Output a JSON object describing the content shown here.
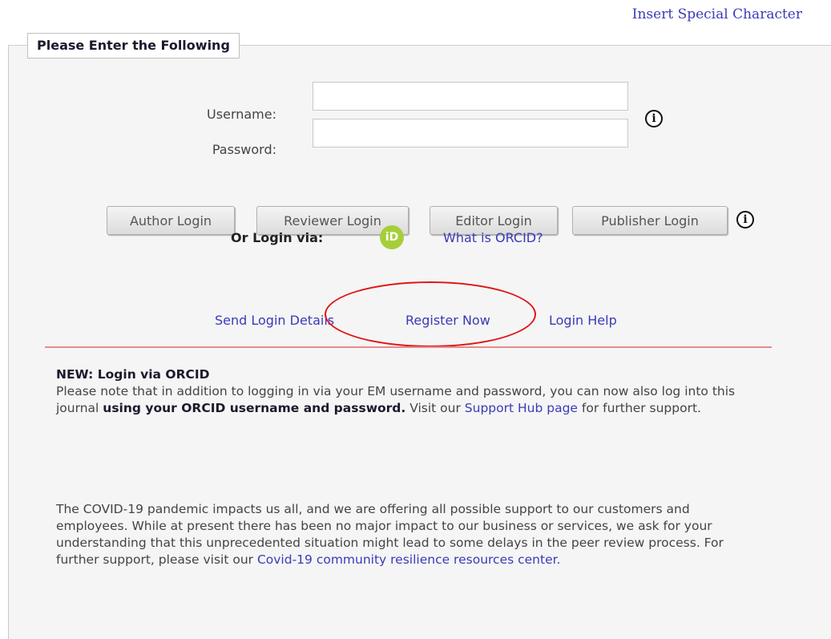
{
  "header": {
    "special_char_link": "Insert Special Character"
  },
  "login_form": {
    "legend": "Please Enter the Following",
    "username_label": "Username:",
    "username_value": "",
    "password_label": "Password:",
    "password_value": "",
    "info_icon_glyph": "i"
  },
  "login_buttons": {
    "author": "Author Login",
    "reviewer": "Reviewer Login",
    "editor": "Editor Login",
    "publisher": "Publisher Login"
  },
  "orcid": {
    "or_login_via": "Or Login via:",
    "badge_text": "iD",
    "badge_color": "#a6ce39",
    "what_is": "What is ORCID?"
  },
  "links": {
    "send_login_details": "Send Login Details",
    "register_now": "Register Now",
    "login_help": "Login Help"
  },
  "notice_orcid": {
    "heading": "NEW: Login via ORCID",
    "text_1": "Please note that in addition to logging in via your EM username and password, you can now also log into this journal ",
    "bold": "using your ORCID username and password.",
    "text_2": " Visit our ",
    "link": "Support Hub page",
    "text_3": " for further support."
  },
  "notice_covid": {
    "text_1": "The COVID-19 pandemic impacts us all, and we are offering all possible support to our customers and employees. While at present there has been no major impact to our business or services, we ask for your understanding that this unprecedented situation might lead to some delays in the peer review process. For further support, please visit our ",
    "link": "Covid-19 community resilience resources center."
  },
  "colors": {
    "link": "#3a3ab8",
    "highlight": "#e01515",
    "divider": "#e88a8a"
  }
}
